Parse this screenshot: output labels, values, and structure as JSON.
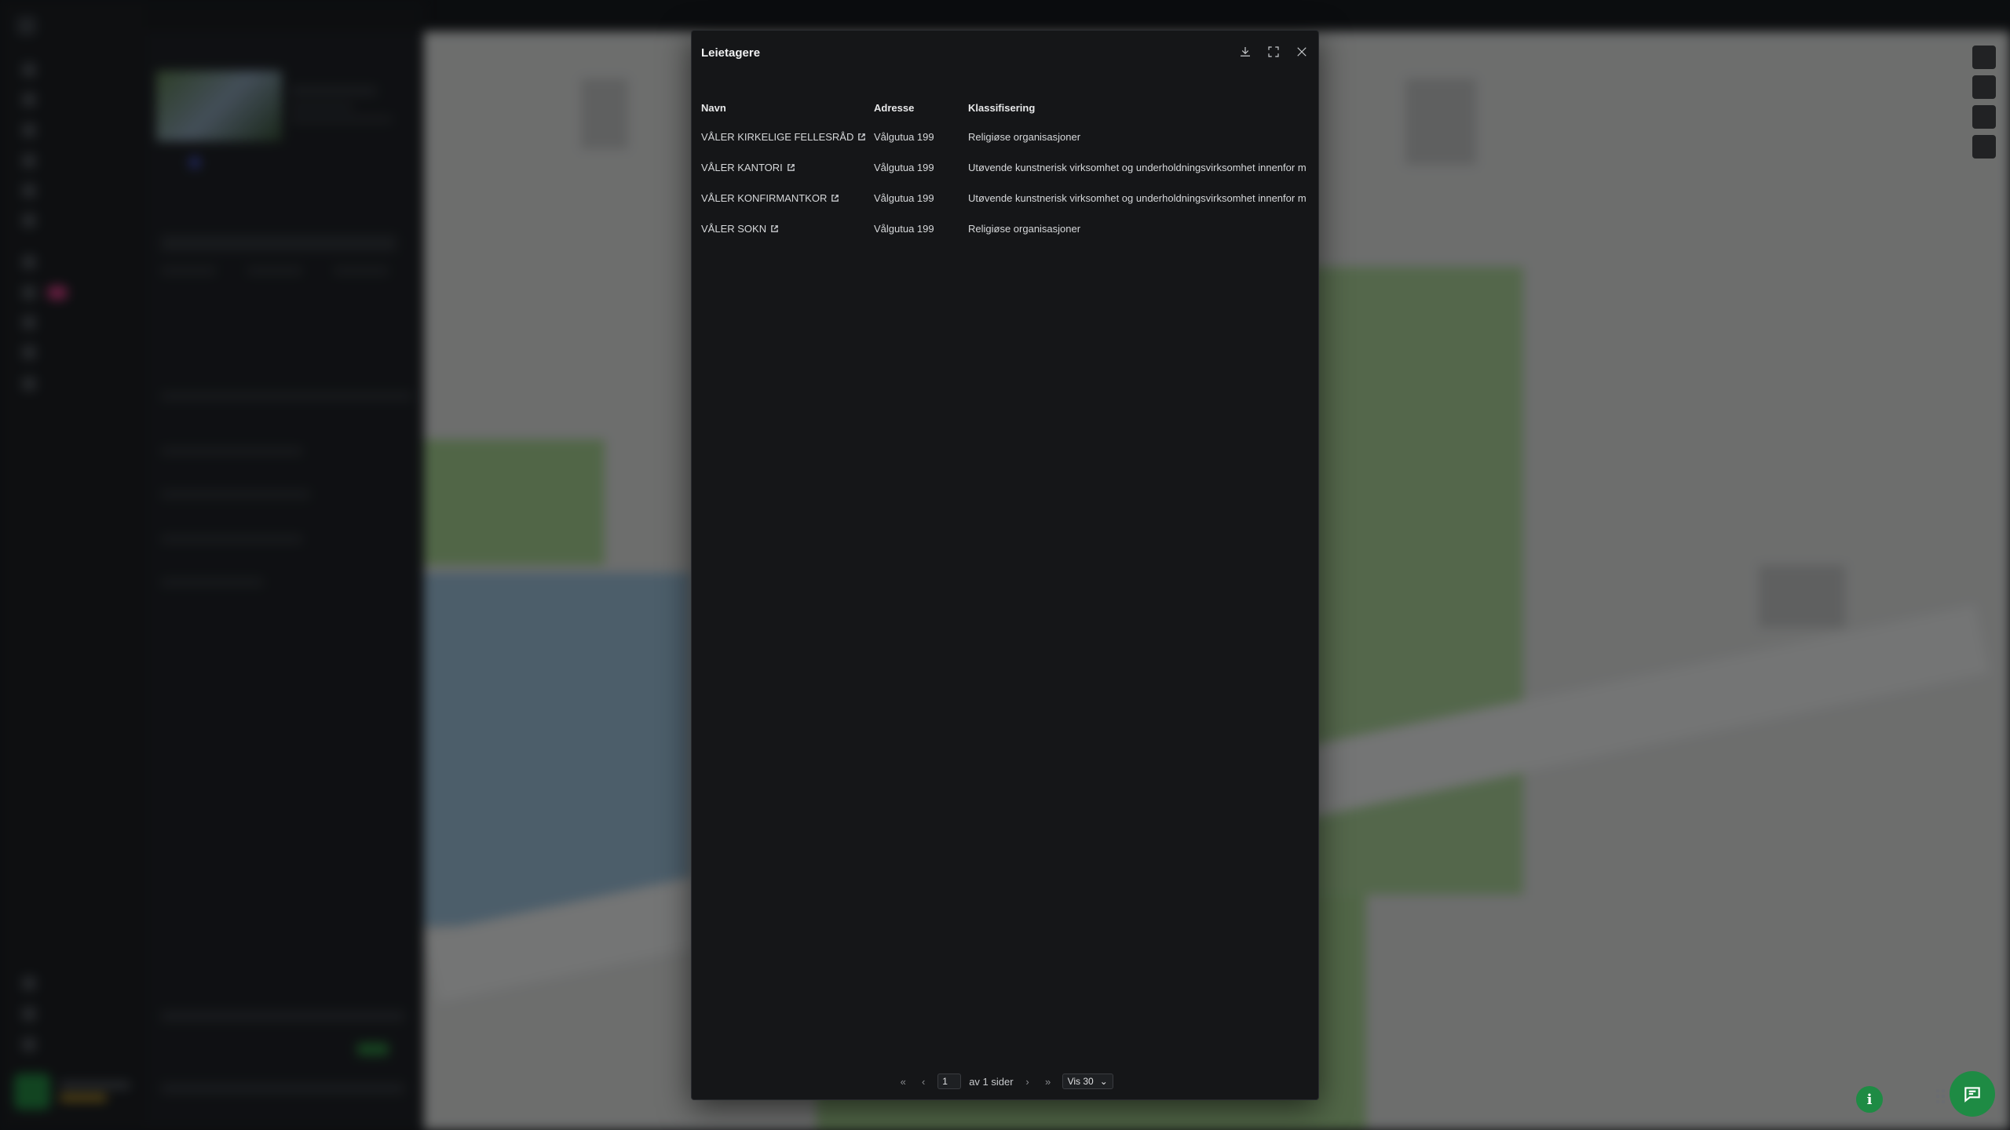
{
  "modal": {
    "title": "Leietagere",
    "columns": [
      "Navn",
      "Adresse",
      "Klassifisering"
    ],
    "rows": [
      {
        "name": "VÅLER KIRKELIGE FELLESRÅD",
        "address": "Vålgutua 199",
        "classification": "Religiøse organisasjoner"
      },
      {
        "name": "VÅLER KANTORI",
        "address": "Vålgutua 199",
        "classification": "Utøvende kunstnerisk virksomhet og underholdningsvirksomhet innenfor m"
      },
      {
        "name": "VÅLER KONFIRMANTKOR",
        "address": "Vålgutua 199",
        "classification": "Utøvende kunstnerisk virksomhet og underholdningsvirksomhet innenfor m"
      },
      {
        "name": "VÅLER SOKN",
        "address": "Vålgutua 199",
        "classification": "Religiøse organisasjoner"
      }
    ],
    "icons": {
      "download": "download-icon",
      "expand": "expand-icon",
      "close": "close-icon",
      "external": "external-link-icon"
    }
  },
  "pager": {
    "first": "«",
    "prev": "‹",
    "page_value": "1",
    "of_text": "av 1 sider",
    "next": "›",
    "last": "»",
    "page_size": "Vis 30"
  },
  "fabs": {
    "info": "i"
  },
  "colors": {
    "accent_green": "#1e8b44",
    "modal_bg": "#151618"
  }
}
